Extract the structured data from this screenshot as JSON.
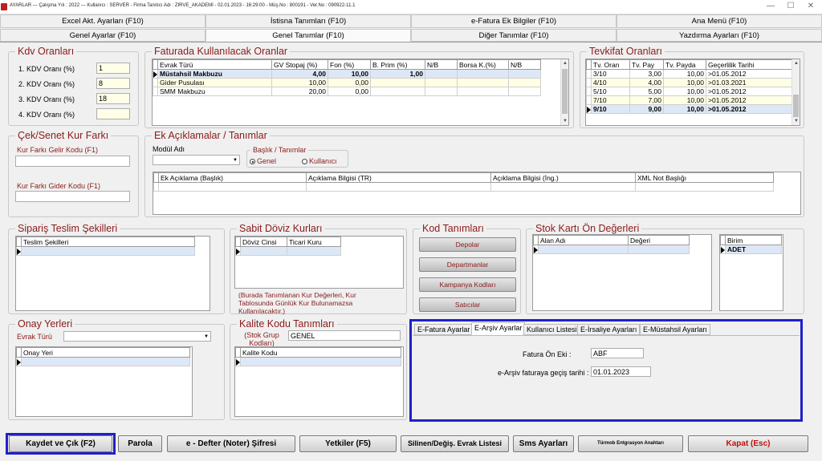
{
  "window": {
    "title": "AYARLAR --- Çalışma Yılı : 2022 --- Kullanıcı : SERVER - Firma Tanıtıcı Adı : ZIRVE_AKADEMI - 02.01.2023 - 16:29:00 - Müş.No : 800191 - Ver.No : 090922-11.1"
  },
  "tabs_top": [
    "Excel Akt. Ayarları (F10)",
    "İstisna Tanımları (F10)",
    "e-Fatura Ek Bilgiler (F10)",
    "Ana Menü (F10)"
  ],
  "tabs_main": [
    "Genel Ayarlar (F10)",
    "Genel Tanımlar (F10)",
    "Diğer Tanımlar (F10)",
    "Yazdırma Ayarları (F10)"
  ],
  "kdv": {
    "title": "Kdv Oranları",
    "rows": [
      {
        "label": "1. KDV Oranı (%)",
        "value": "1"
      },
      {
        "label": "2. KDV Oranı (%)",
        "value": "8"
      },
      {
        "label": "3. KDV Oranı (%)",
        "value": "18"
      },
      {
        "label": "4. KDV Oranı (%)",
        "value": ""
      }
    ]
  },
  "faturada": {
    "title": "Faturada Kullanılacak Oranlar",
    "columns": [
      "Evrak Türü",
      "GV Stopaj (%)",
      "Fon (%)",
      "B. Prim (%)",
      "N/B",
      "Borsa K.(%)",
      "N/B"
    ],
    "rows": [
      [
        "Müstahsil Makbuzu",
        "4,00",
        "10,00",
        "1,00",
        "",
        "",
        ""
      ],
      [
        "Gider Pusulası",
        "10,00",
        "0,00",
        "",
        "",
        "",
        ""
      ],
      [
        "SMM Makbuzu",
        "20,00",
        "0,00",
        "",
        "",
        "",
        ""
      ]
    ]
  },
  "tevkifat": {
    "title": "Tevkifat Oranları",
    "columns": [
      "Tv. Oran",
      "Tv. Pay",
      "Tv. Payda",
      "Geçerlilik Tarihi"
    ],
    "rows": [
      [
        "3/10",
        "3,00",
        "10,00",
        ">01.05.2012"
      ],
      [
        "4/10",
        "4,00",
        "10,00",
        ">01.03.2021"
      ],
      [
        "5/10",
        "5,00",
        "10,00",
        ">01.05.2012"
      ],
      [
        "7/10",
        "7,00",
        "10,00",
        ">01.05.2012"
      ],
      [
        "9/10",
        "9,00",
        "10,00",
        ">01.05.2012"
      ]
    ]
  },
  "cek": {
    "title": "Çek/Senet Kur Farkı",
    "gelir_label": "Kur Farkı Gelir Kodu (F1)",
    "gider_label": "Kur Farkı Gider Kodu (F1)"
  },
  "ek": {
    "title": "Ek Açıklamalar / Tanımlar",
    "modul_label": "Modül Adı",
    "baslik_label": "Başlık / Tanımlar",
    "radio_genel": "Genel",
    "radio_kullanici": "Kullanıcı",
    "columns": [
      "Ek Açıklama (Başlık)",
      "Açıklama Bilgisi (TR)",
      "Açıklama Bilgisi (İng.)",
      "XML Not Başlığı"
    ]
  },
  "siparis": {
    "title": "Sipariş Teslim Şekilleri",
    "column": "Teslim Şekilleri"
  },
  "doviz": {
    "title": "Sabit Döviz Kurları",
    "columns": [
      "Döviz Cinsi",
      "Ticari Kuru"
    ],
    "note": "(Burada Tanımlanan Kur Değerleri, Kur Tablosunda Günlük Kur Bulunamazsa Kullanılacaktır.)"
  },
  "kod": {
    "title": "Kod Tanımları",
    "buttons": [
      "Depolar",
      "Departmanlar",
      "Kampanya Kodları",
      "Satıcılar"
    ]
  },
  "stok": {
    "title": "Stok Kartı Ön Değerleri",
    "columns": [
      "Alan Adı",
      "Değeri"
    ],
    "birim_column": "Birim",
    "birim_value": "ADET"
  },
  "onay": {
    "title": "Onay Yerleri",
    "evrak_label": "Evrak Türü",
    "column": "Onay Yeri"
  },
  "kalite": {
    "title": "Kalite Kodu Tanımları",
    "grup_label": "(Stok Grup Kodları)",
    "grup_value": "GENEL",
    "column": "Kalite Kodu"
  },
  "efatura": {
    "tabs": [
      "E-Fatura Ayarlar",
      "E-Arşiv Ayarlar",
      "Kullanıcı Listesi",
      "E-İrsaliye Ayarları",
      "E-Müstahsil Ayarları"
    ],
    "active_tab": 1,
    "onek_label": "Fatura Ön Eki :",
    "onek_value": "ABF",
    "tarih_label": "e-Arşiv faturaya geçiş tarihi :",
    "tarih_value": "01.01.2023"
  },
  "bottom_buttons": [
    "Kaydet ve Çık (F2)",
    "Parola",
    "e - Defter (Noter) Şifresi",
    "Yetkiler (F5)",
    "Silinen/Değiş. Evrak Listesi",
    "Sms Ayarları",
    "Türmob Entgrasyon Anahtarı",
    "Kapat (Esc)"
  ],
  "colors": {
    "accent_red": "#8b1a1a",
    "highlight_blue": "#2020c8"
  }
}
